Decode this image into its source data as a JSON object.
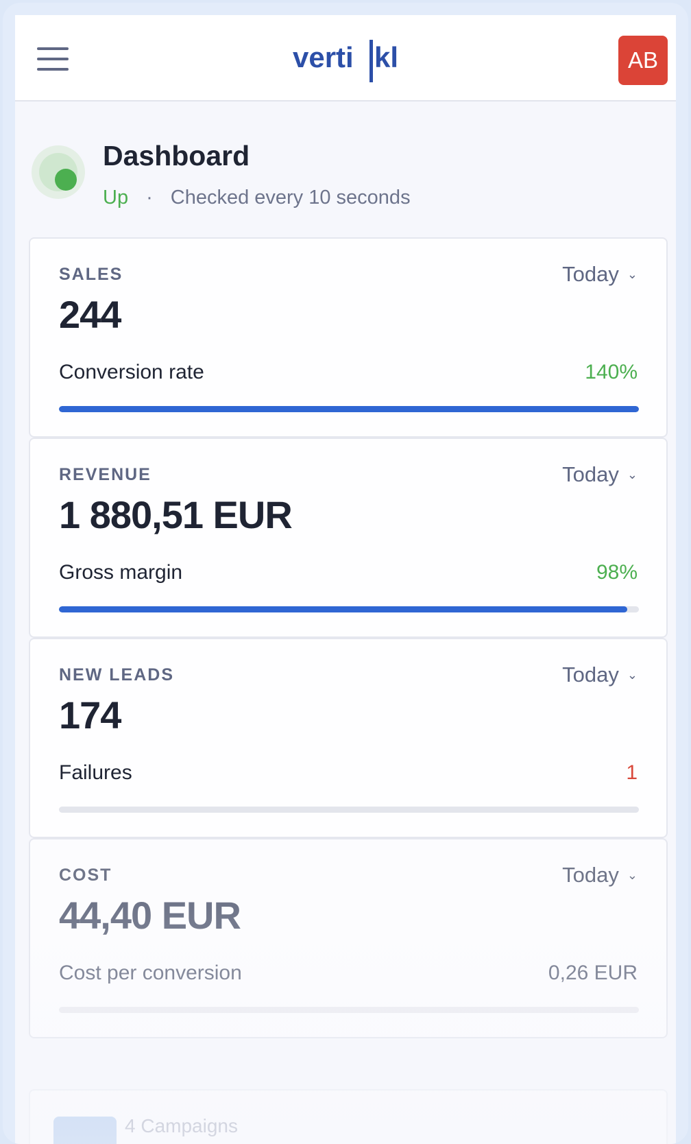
{
  "header": {
    "menu_icon": "hamburger-menu-icon",
    "logo_text": "vertikl",
    "avatar_initials": "AB",
    "colors": {
      "brand": "#2c4fa8",
      "avatar": "#db4437"
    }
  },
  "status": {
    "title": "Dashboard",
    "state": "Up",
    "separator": "·",
    "check_text": "Checked every 10 seconds",
    "colors": {
      "up": "#4caf50"
    }
  },
  "cards": [
    {
      "label": "SALES",
      "range": "Today",
      "value": "244",
      "metric_label": "Conversion rate",
      "metric_value": "140%",
      "metric_color": "#4caf50",
      "progress": 1.0
    },
    {
      "label": "REVENUE",
      "range": "Today",
      "value": "1 880,51 EUR",
      "metric_label": "Gross margin",
      "metric_value": "98%",
      "metric_color": "#4caf50",
      "progress": 0.98
    },
    {
      "label": "NEW LEADS",
      "range": "Today",
      "value": "174",
      "metric_label": "Failures",
      "metric_value": "1",
      "metric_color": "#d9483b",
      "progress": 0
    },
    {
      "label": "COST",
      "range": "Today",
      "value": "44,40 EUR",
      "metric_label": "Cost per conversion",
      "metric_value": "0,26 EUR",
      "metric_color": "#6f7589",
      "progress": 0
    }
  ],
  "campaigns": {
    "label": "4 Campaigns"
  },
  "colors": {
    "accent": "#2f66d3",
    "background": "#f6f7fc",
    "text": "#1f2433",
    "muted": "#5f6783"
  }
}
